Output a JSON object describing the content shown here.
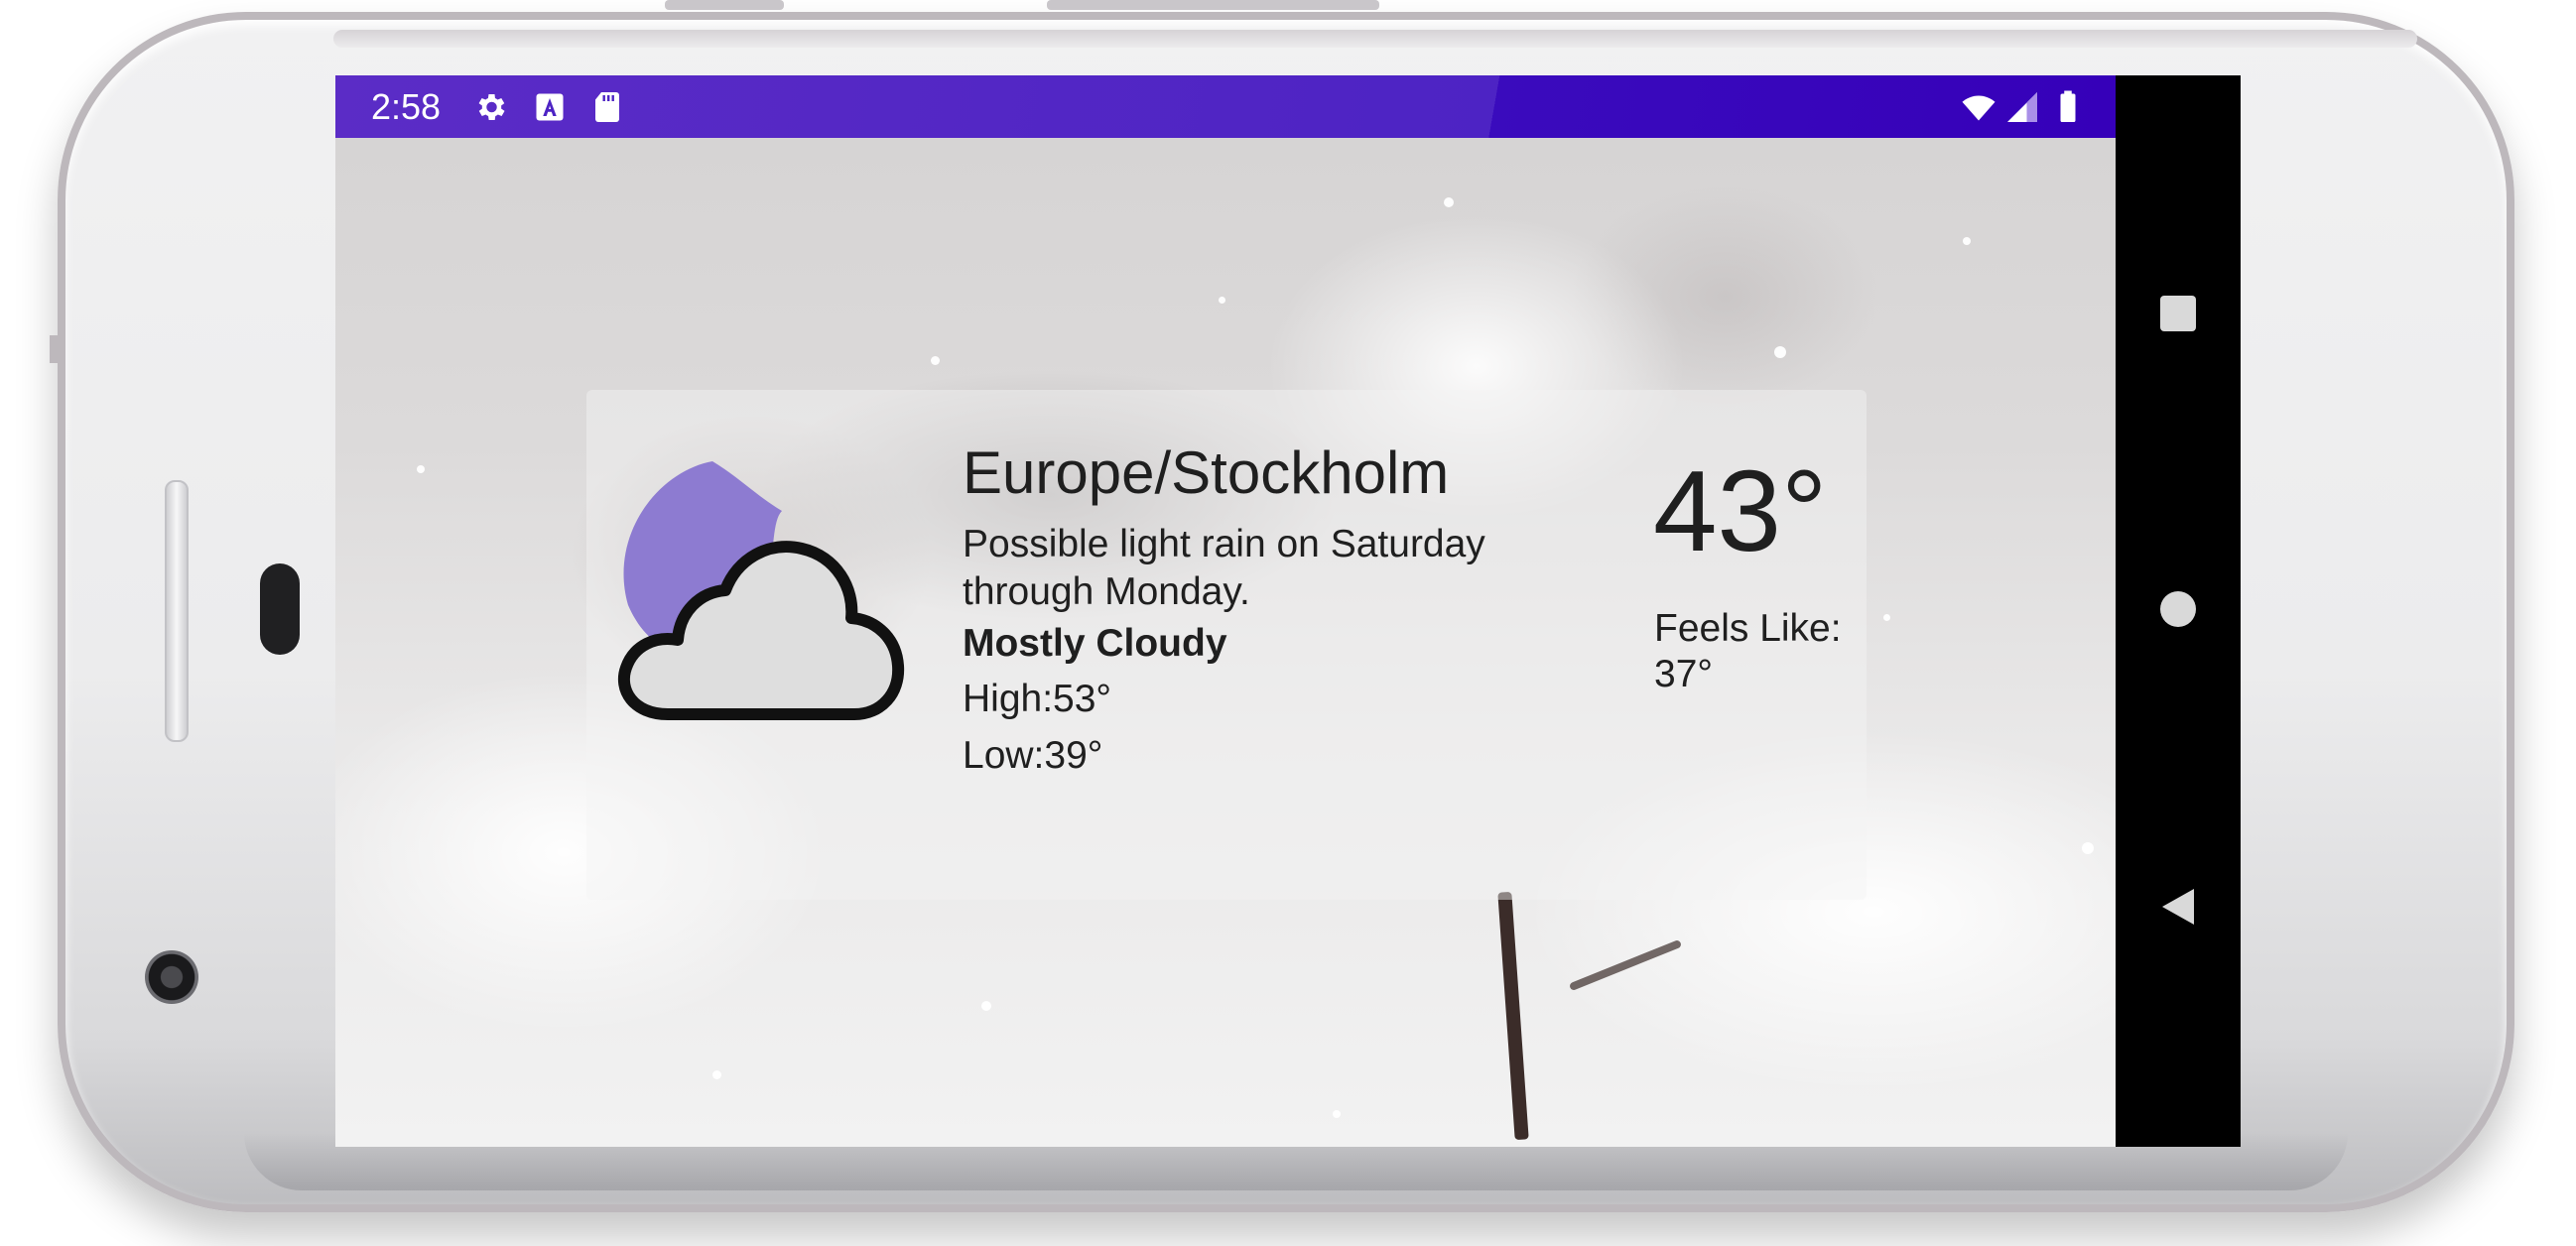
{
  "status_bar": {
    "time": "2:58",
    "left_icons": [
      "gear-icon",
      "font-a-icon",
      "sd-card-icon"
    ],
    "right_icons": [
      "wifi-icon",
      "signal-icon",
      "battery-icon"
    ],
    "color": "#4d23c4"
  },
  "nav_bar": {
    "buttons": [
      "recents-square-icon",
      "home-circle-icon",
      "back-triangle-icon"
    ]
  },
  "weather": {
    "location": "Europe/Stockholm",
    "forecast": "Possible light rain on Saturday through Monday.",
    "condition": "Mostly Cloudy",
    "high": "High:53°",
    "low": "Low:39°",
    "temperature": "43°",
    "feels_like_label": "Feels Like:",
    "feels_like_value": "37°",
    "icon": "partly-cloudy-night-icon",
    "moon_color": "#8d7bd1"
  }
}
